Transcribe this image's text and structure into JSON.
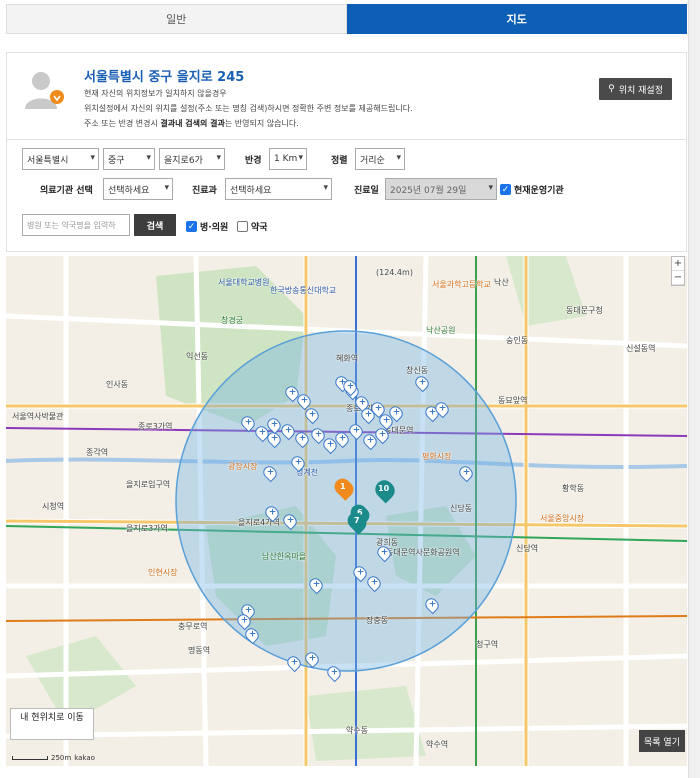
{
  "tabs": [
    {
      "label": "일반",
      "active": false
    },
    {
      "label": "지도",
      "active": true
    }
  ],
  "location": {
    "address": "서울특별시 중구 을지로 245",
    "desc_line1": "현재 자신의 위치정보가 일치하지 않을경우",
    "desc_line2": "위치설정에서 자신의 위치를 설정(주소 또는 명칭 검색)하시면 정확한 주변 정보를 제공해드립니다.",
    "desc_line3_a": "주소 또는 반경 변경시",
    "desc_line3_b": "결과내 검색의 결과",
    "desc_line3_c": "는 반영되지 않습니다.",
    "reset_label": "위치 재설정"
  },
  "filters": {
    "sido": "서울특별시",
    "sigungu": "중구",
    "dong": "을지로6가",
    "radius_label": "반경",
    "radius": "1 Km",
    "sort_label": "정렬",
    "sort": "거리순",
    "inst_label": "의료기관 선택",
    "inst": "선택하세요",
    "dept_label": "진료과",
    "dept": "선택하세요",
    "date_label": "진료일",
    "date": "2025년 07월 29일",
    "open_label": "현재운영기관",
    "search_placeholder": "병원 또는 약국명을 입력하",
    "search_button": "검색",
    "hospital_label": "병·의원",
    "pharmacy_label": "약국"
  },
  "map": {
    "labels": [
      {
        "t": "서울대학교병원",
        "c": "blue"
      },
      {
        "t": "혜화역",
        "c": ""
      },
      {
        "t": "창경궁",
        "c": "green"
      },
      {
        "t": "서울과학고등학교",
        "c": "orange"
      },
      {
        "t": "한국방송통신대학교",
        "c": "blue"
      },
      {
        "t": "낙산",
        "c": ""
      },
      {
        "t": "동대문역",
        "c": ""
      },
      {
        "t": "동대문역사문화공원역",
        "c": ""
      },
      {
        "t": "을지로3가역",
        "c": ""
      },
      {
        "t": "을지로4가역",
        "c": ""
      },
      {
        "t": "충무로역",
        "c": ""
      },
      {
        "t": "종로3가역",
        "c": ""
      },
      {
        "t": "청계천",
        "c": "blue"
      },
      {
        "t": "광희동",
        "c": ""
      },
      {
        "t": "신당역",
        "c": ""
      },
      {
        "t": "청구역",
        "c": ""
      },
      {
        "t": "약수역",
        "c": ""
      },
      {
        "t": "동묘앞역",
        "c": ""
      },
      {
        "t": "신설동역",
        "c": ""
      },
      {
        "t": "종로5가역",
        "c": ""
      },
      {
        "t": "창신동",
        "c": ""
      },
      {
        "t": "숭인동",
        "c": ""
      },
      {
        "t": "황학동",
        "c": ""
      },
      {
        "t": "장충동",
        "c": ""
      },
      {
        "t": "인현시장",
        "c": "orange"
      },
      {
        "t": "광장시장",
        "c": "orange"
      },
      {
        "t": "평화시장",
        "c": "orange"
      },
      {
        "t": "서울중앙시장",
        "c": "orange"
      },
      {
        "t": "남산한옥마을",
        "c": "green"
      },
      {
        "t": "명동역",
        "c": ""
      },
      {
        "t": "을지로입구역",
        "c": ""
      },
      {
        "t": "시청역",
        "c": ""
      },
      {
        "t": "종각역",
        "c": ""
      },
      {
        "t": "인사동",
        "c": ""
      },
      {
        "t": "익선동",
        "c": ""
      },
      {
        "t": "서울역사박물관",
        "c": ""
      },
      {
        "t": "낙산공원",
        "c": "green"
      },
      {
        "t": "동대문구청",
        "c": ""
      },
      {
        "t": "신당동",
        "c": ""
      },
      {
        "t": "약수동",
        "c": ""
      }
    ],
    "markers": [
      "1",
      "10",
      "6",
      "7"
    ],
    "current_location_button": "내 현위치로 이동",
    "scale_label": "250m",
    "brand": "kakao",
    "list_button": "목록 열기",
    "peak_label": "(124.4m)"
  }
}
